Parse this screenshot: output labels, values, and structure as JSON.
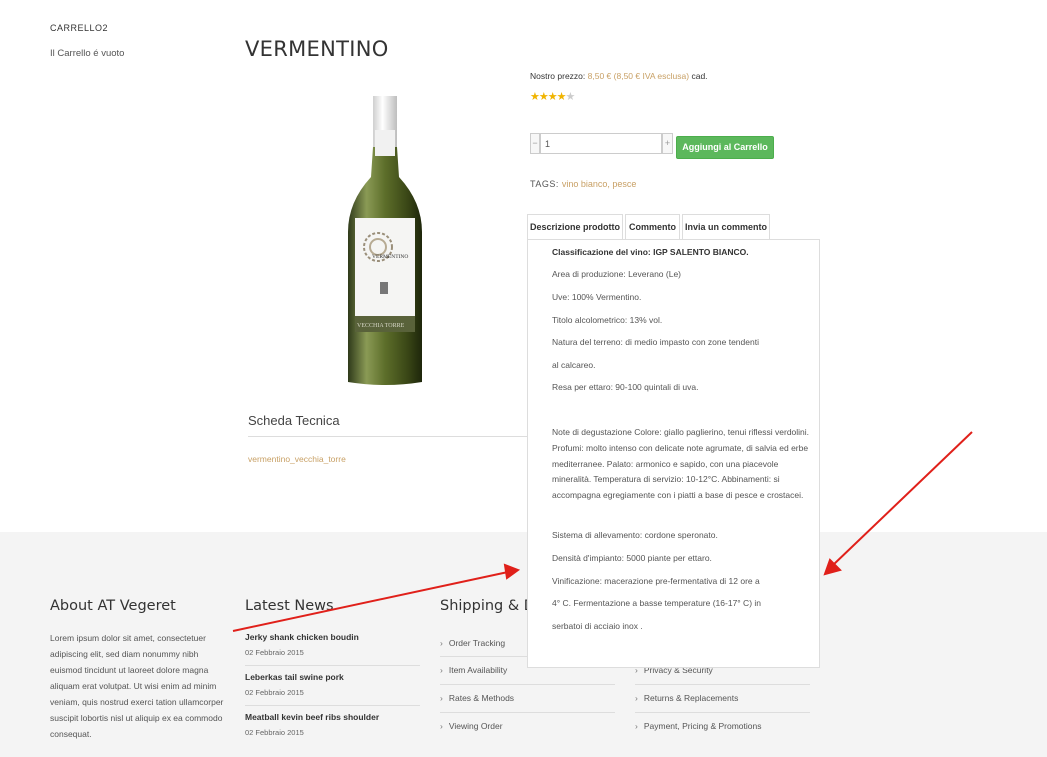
{
  "sidebar": {
    "cart_title": "CARRELLO2",
    "cart_empty": "Il Carrello é vuoto"
  },
  "product": {
    "title": "VERMENTINO",
    "bottle_label": "VERMENTINO",
    "bottle_brand": "VECCHIA TORRE",
    "price_prefix": "Nostro prezzo:",
    "price_amount": "8,50 € (8,50 € IVA esclusa)",
    "price_suffix": "cad.",
    "rating": 4,
    "rating_max": 5,
    "star_on_color": "#f0b400",
    "star_off_color": "#cccccc",
    "qty_minus": "−",
    "qty_value": "1",
    "qty_plus": "+",
    "add_button": "Aggiungi al Carrello",
    "add_button_color": "#5cb85c",
    "tags_label": "TAGS:",
    "tags": "vino bianco, pesce",
    "accent_color": "#c8a065"
  },
  "tabs": [
    {
      "label": "Descrizione prodotto"
    },
    {
      "label": "Commento"
    },
    {
      "label": "Invia un commento"
    }
  ],
  "description": {
    "heading": "Classificazione del vino: IGP SALENTO BIANCO.",
    "lines": [
      "Area di produzione: Leverano (Le)",
      "Uve: 100% Vermentino.",
      "Titolo alcolometrico: 13% vol.",
      "Natura del terreno: di medio impasto con zone tendenti",
      "al calcareo.",
      "Resa per ettaro: 90-100 quintali di uva."
    ],
    "notes": "Note di degustazione Colore: giallo paglierino, tenui riflessi verdolini. Profumi: molto intenso con delicate note agrumate, di salvia ed erbe mediterranee. Palato: armonico e sapido, con una piacevole mineralità. Temperatura di servizio: 10-12°C. Abbinamenti: si accompagna egregiamente con i piatti a base di pesce e crostacei.",
    "lines2": [
      "Sistema di allevamento: cordone speronato.",
      "Densità d'impianto: 5000 piante per ettaro.",
      "Vinificazione: macerazione pre-fermentativa di 12 ore a",
      "4° C. Fermentazione a basse temperature (16-17° C) in",
      "serbatoi di acciaio inox ."
    ]
  },
  "scheda": {
    "title": "Scheda Tecnica",
    "link": "vermentino_vecchia_torre"
  },
  "footer": {
    "about_title": "About AT Vegeret",
    "about_text": "Lorem ipsum dolor sit amet, consectetuer adipiscing elit, sed diam nonummy nibh euismod tincidunt ut laoreet dolore magna aliquam erat volutpat. Ut wisi enim ad minim veniam, quis nostrud exerci tation ullamcorper suscipit lobortis nisl ut aliquip ex ea commodo consequat.",
    "news_title": "Latest News",
    "news": [
      {
        "title": "Jerky shank chicken boudin",
        "date": "02 Febbraio 2015"
      },
      {
        "title": "Leberkas tail swine pork",
        "date": "02 Febbraio 2015"
      },
      {
        "title": "Meatball kevin beef ribs shoulder",
        "date": "02 Febbraio 2015"
      }
    ],
    "shipping_title": "Shipping & D",
    "shipping": [
      "Order Tracking",
      "Item Availability",
      "Rates & Methods",
      "Viewing Order"
    ],
    "info": [
      "Privacy & Security",
      "Returns & Replacements",
      "Payment, Pricing & Promotions"
    ],
    "chevron": "›"
  },
  "annotation_color": "#e0201a"
}
